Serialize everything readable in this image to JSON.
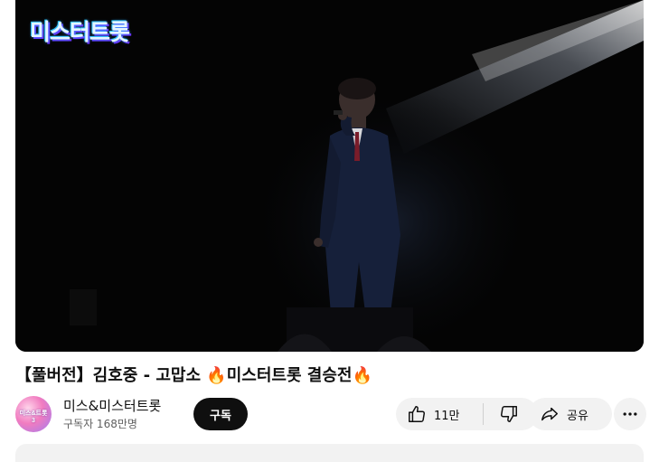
{
  "video": {
    "title": "【풀버전】김호중 - 고맙소 🔥미스터트롯 결승전🔥",
    "logo_text": "미스터트롯"
  },
  "channel": {
    "name": "미스&미스터트롯",
    "subscribers": "구독자 168만명",
    "avatar_text": "미스&트롯3"
  },
  "actions": {
    "subscribe_label": "구독",
    "like_count": "11만",
    "share_label": "공유"
  },
  "icons": [
    "like-icon",
    "dislike-icon",
    "share-icon",
    "more-icon"
  ],
  "colors": {
    "subscribe_bg": "#0f0f0f",
    "pill_bg": "#f2f2f2"
  }
}
